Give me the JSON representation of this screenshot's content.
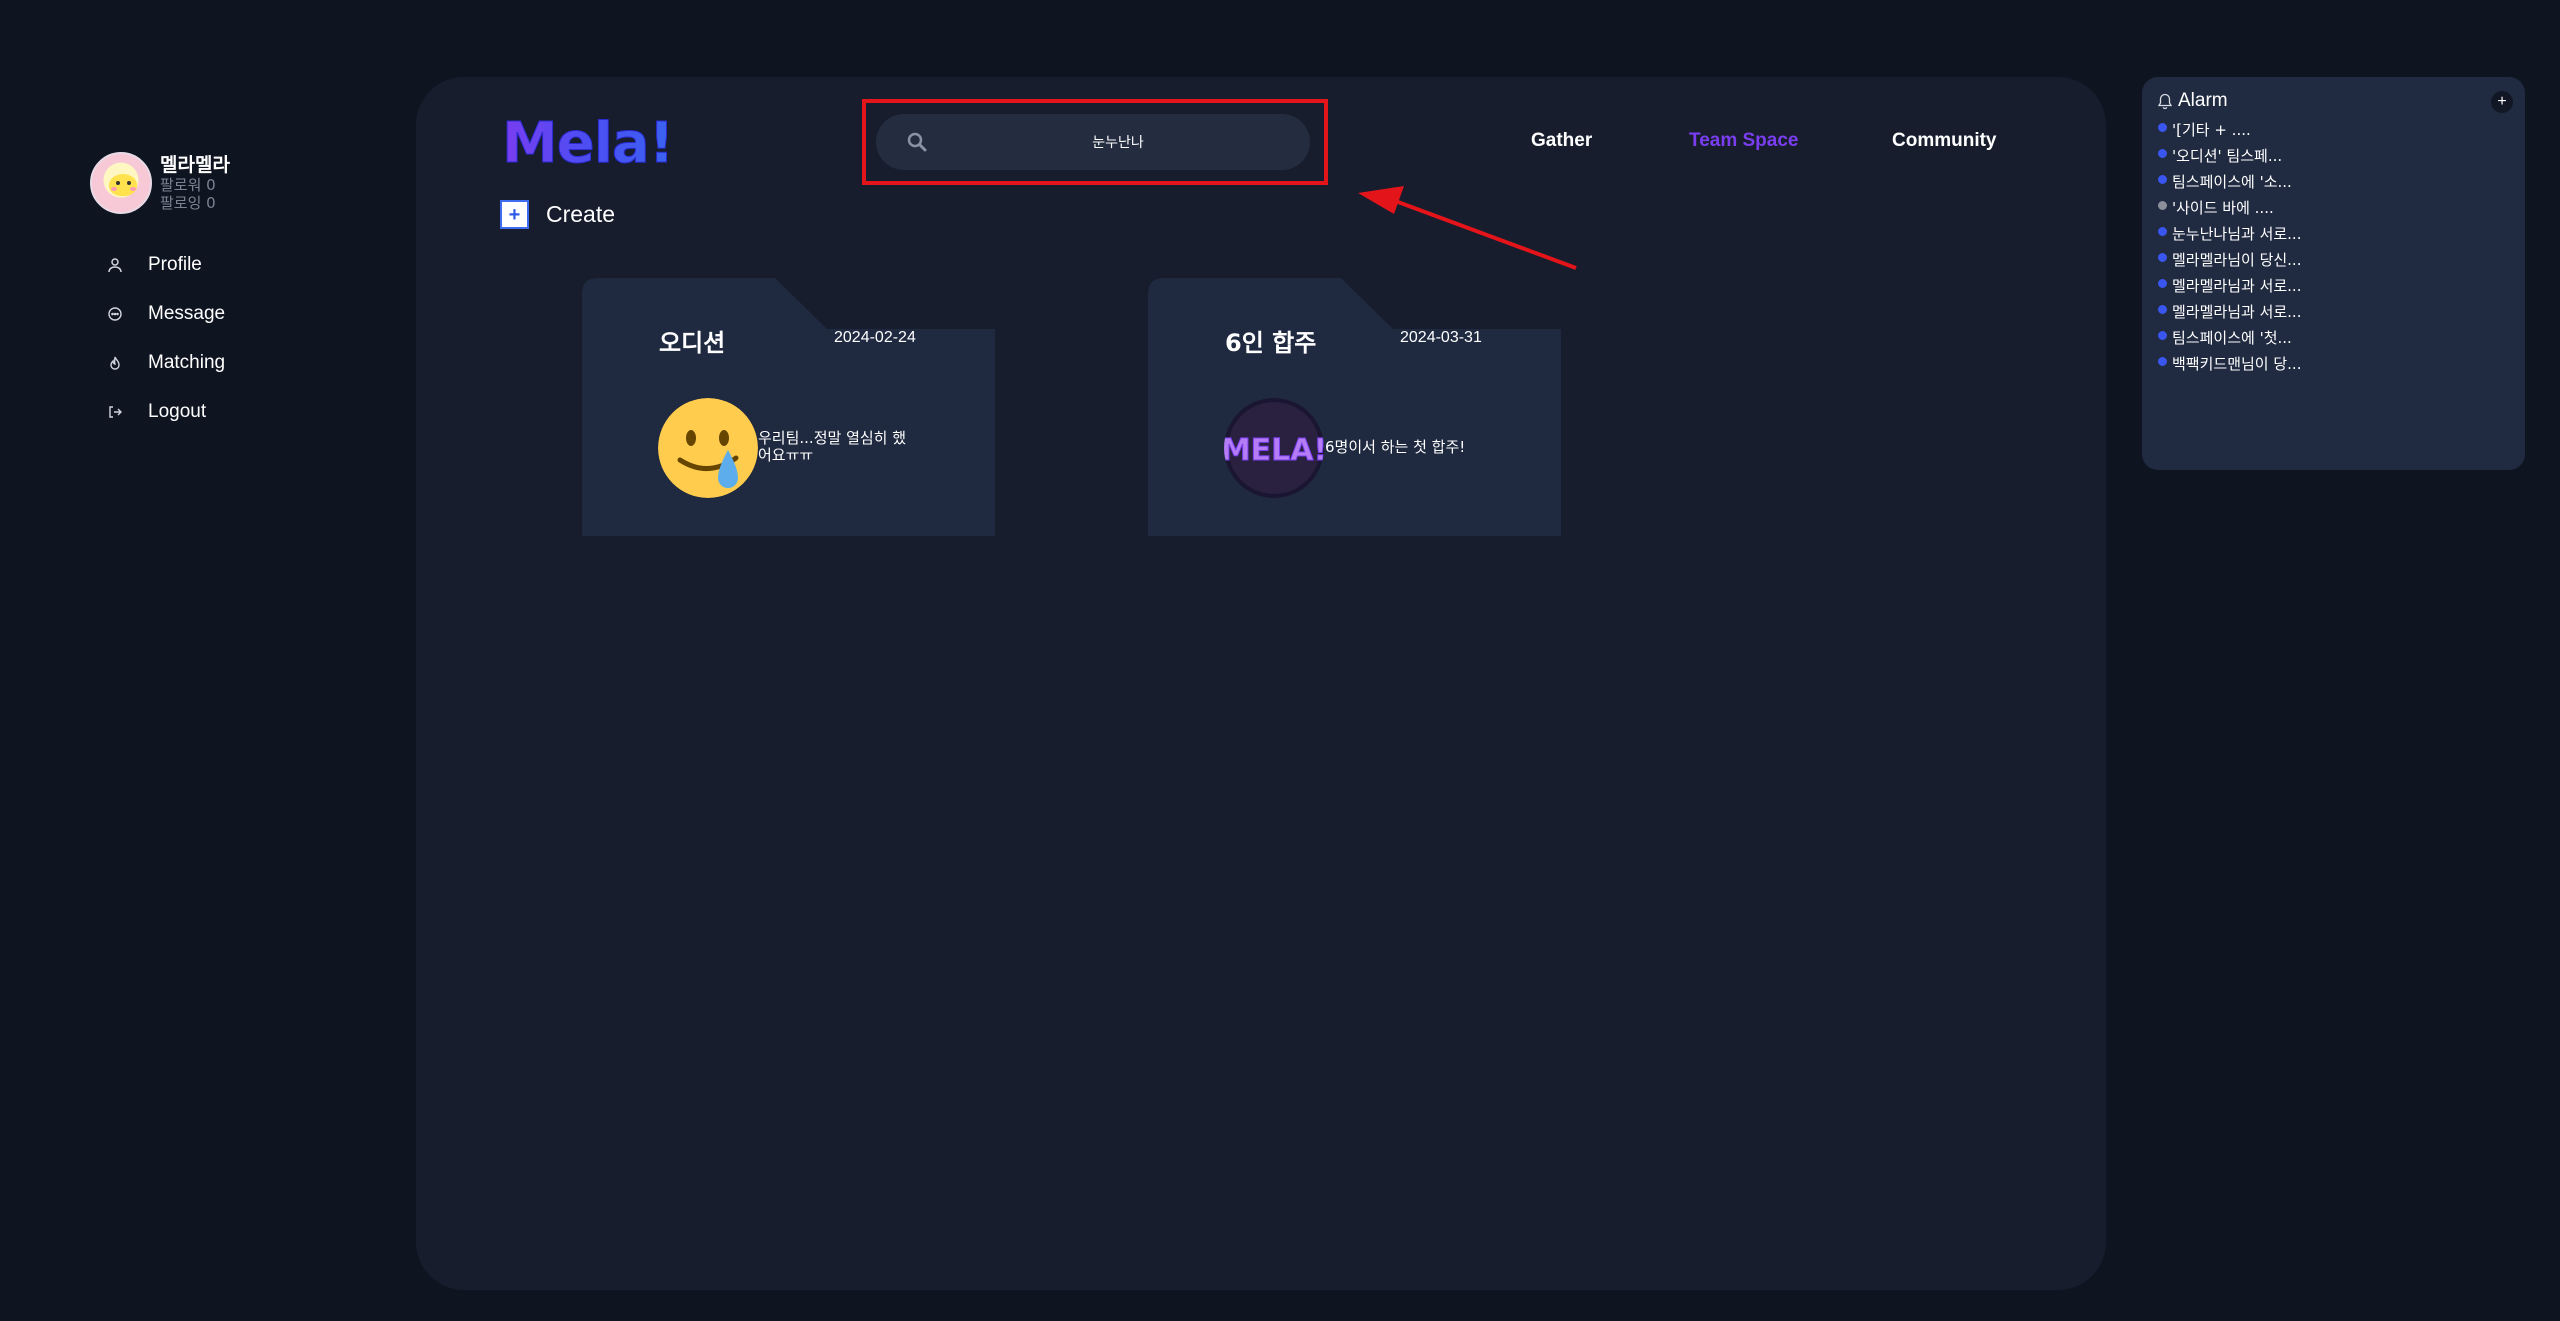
{
  "profile": {
    "name": "멜라멜라",
    "followers": "팔로워 0",
    "following": "팔로잉 0"
  },
  "side_nav": [
    {
      "label": "Profile",
      "icon": "user-icon"
    },
    {
      "label": "Message",
      "icon": "message-icon"
    },
    {
      "label": "Matching",
      "icon": "flame-icon"
    },
    {
      "label": "Logout",
      "icon": "logout-icon"
    }
  ],
  "logo": "Mela!",
  "search": {
    "value": "눈누난나"
  },
  "top_nav": {
    "gather": "Gather",
    "team_space": "Team Space",
    "community": "Community",
    "active_color": "#7a3df0"
  },
  "create_label": "Create",
  "cards": [
    {
      "title": "오디션",
      "date": "2024-02-24",
      "description": "우리팀...정말 열심히 했어요ㅠㅠ",
      "image": "crying-smile-emoji"
    },
    {
      "title": "6인 합주",
      "date": "2024-03-31",
      "description": "6명이서 하는 첫 합주!",
      "image": "mela-logo-thumbnail",
      "image_text": "MELA!"
    }
  ],
  "alarm": {
    "title": "Alarm",
    "add_label": "+",
    "items": [
      {
        "text": "'[기타 + ....",
        "color": "#3a56f0"
      },
      {
        "text": "'오디션' 팀스페...",
        "color": "#3a56f0"
      },
      {
        "text": "팀스페이스에 '소...",
        "color": "#3a56f0"
      },
      {
        "text": "'사이드 바에 ....",
        "color": "#8a8f99"
      },
      {
        "text": "눈누난나님과 서로...",
        "color": "#3a56f0"
      },
      {
        "text": "멜라멜라님이 당신...",
        "color": "#3a56f0"
      },
      {
        "text": "멜라멜라님과 서로...",
        "color": "#3a56f0"
      },
      {
        "text": "멜라멜라님과 서로...",
        "color": "#3a56f0"
      },
      {
        "text": "팀스페이스에 '첫...",
        "color": "#3a56f0"
      },
      {
        "text": "백팩키드맨님이 당...",
        "color": "#3a56f0"
      }
    ]
  }
}
